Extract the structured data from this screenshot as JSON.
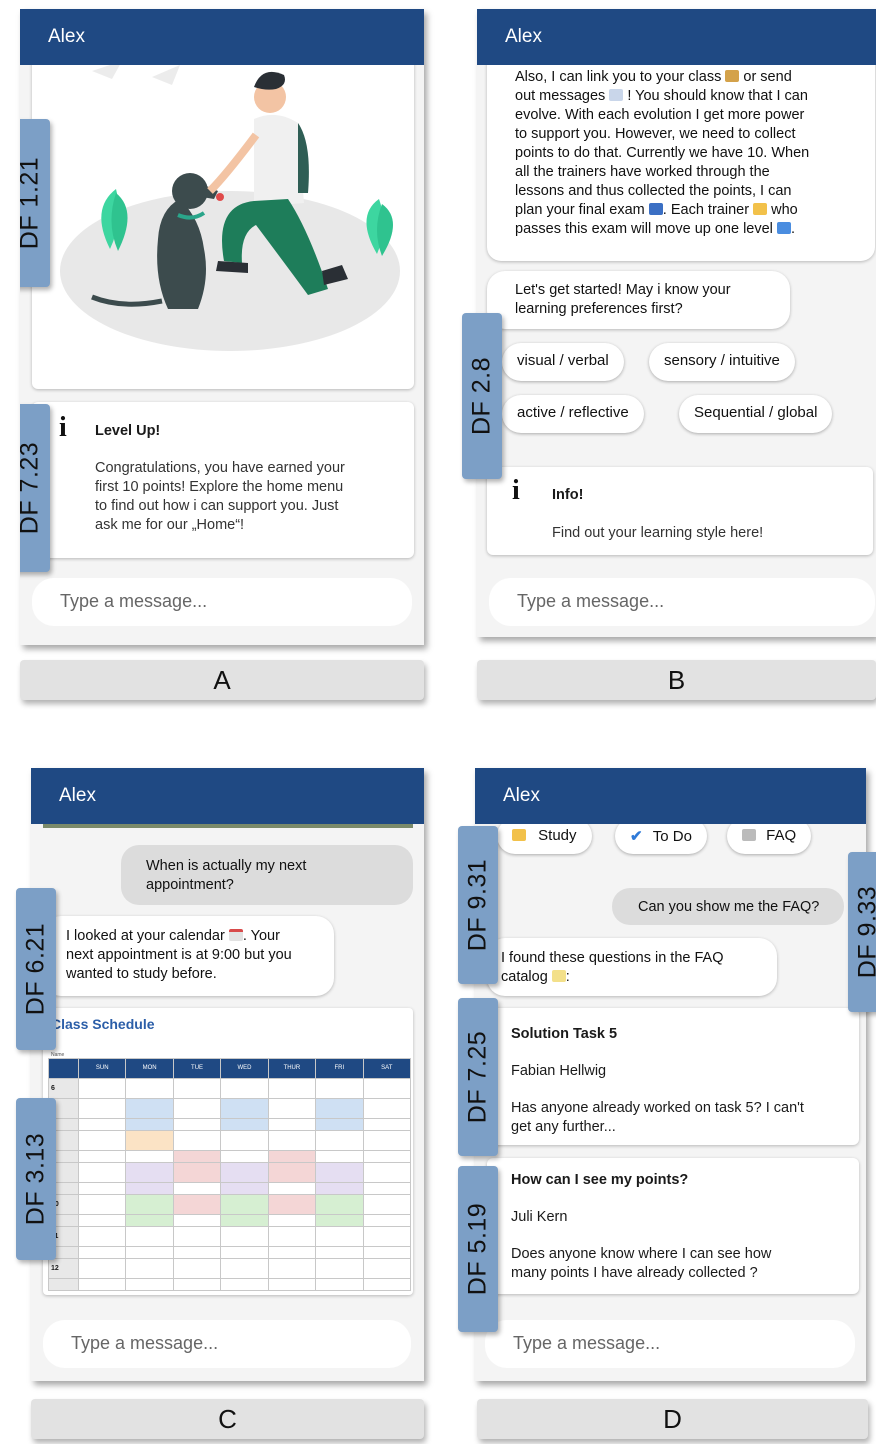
{
  "colors": {
    "header": "#1f4983",
    "tag": "#7c9fc6",
    "panel": "#f4f4f4"
  },
  "panelA": {
    "title": "Alex",
    "tag1": "DF 1.21",
    "tag2": "DF 7.23",
    "card_title": "Level Up!",
    "card_lines": [
      "Congratulations, you have earned your",
      "first 10 points! Explore the home menu",
      "to find out how i can support you. Just",
      "ask me for our „Home“!"
    ],
    "input_placeholder": "Type a message...",
    "label": "A"
  },
  "panelB": {
    "title": "Alex",
    "intro_lines": [
      "Also, I can link you to your class",
      "or send",
      "out messages",
      "! You should know that I can",
      "evolve. With each evolution I get more power",
      "to support you. However, we need to collect",
      "points to do that. Currently we have 10. When",
      "all the trainers have worked through the",
      "lessons and thus collected the points, I can",
      "plan your final exam",
      ". Each trainer",
      "who",
      "passes this exam will move up one level",
      "."
    ],
    "question_lines": [
      "Let's get started! May i know your",
      "learning preferences first?"
    ],
    "chips": [
      "visual / verbal",
      "sensory / intuitive",
      "active / reflective",
      "Sequential / global"
    ],
    "tag": "DF 2.8",
    "info_title": "Info!",
    "info_text": "Find out your learning style here!",
    "input_placeholder": "Type a message...",
    "label": "B"
  },
  "panelC": {
    "title": "Alex",
    "user_lines": [
      "When is actually my next",
      "appointment?"
    ],
    "bot_lines": [
      "I looked at your calendar",
      ". Your",
      "next appointment is at 9:00 but you",
      "wanted to study before."
    ],
    "tag1": "DF 6.21",
    "tag2": "DF 3.13",
    "schedule_title": "Class Schedule",
    "schedule_name_label": "Name",
    "days": [
      "SUN",
      "MON",
      "TUE",
      "WED",
      "THUR",
      "FRI",
      "SAT"
    ],
    "input_placeholder": "Type a message...",
    "label": "C"
  },
  "panelD": {
    "title": "Alex",
    "chips": [
      "Study",
      "To Do",
      "FAQ"
    ],
    "user_text": "Can you show me the FAQ?",
    "bot_lines": [
      "I found these questions in the FAQ",
      "catalog",
      ":"
    ],
    "tag1": "DF 9.31",
    "tag2": "DF 9.33",
    "tag3": "DF 7.25",
    "tag4": "DF 5.19",
    "faq": [
      {
        "title": "Solution Task 5",
        "author": "Fabian Hellwig",
        "lines": [
          "Has anyone already worked on task 5? I can't",
          "get any further..."
        ]
      },
      {
        "title": "How can I see my points?",
        "author": "Juli Kern",
        "lines": [
          "Does anyone know where I can see how",
          "many points I have already collected ?"
        ]
      }
    ],
    "input_placeholder": "Type a message...",
    "label": "D"
  }
}
